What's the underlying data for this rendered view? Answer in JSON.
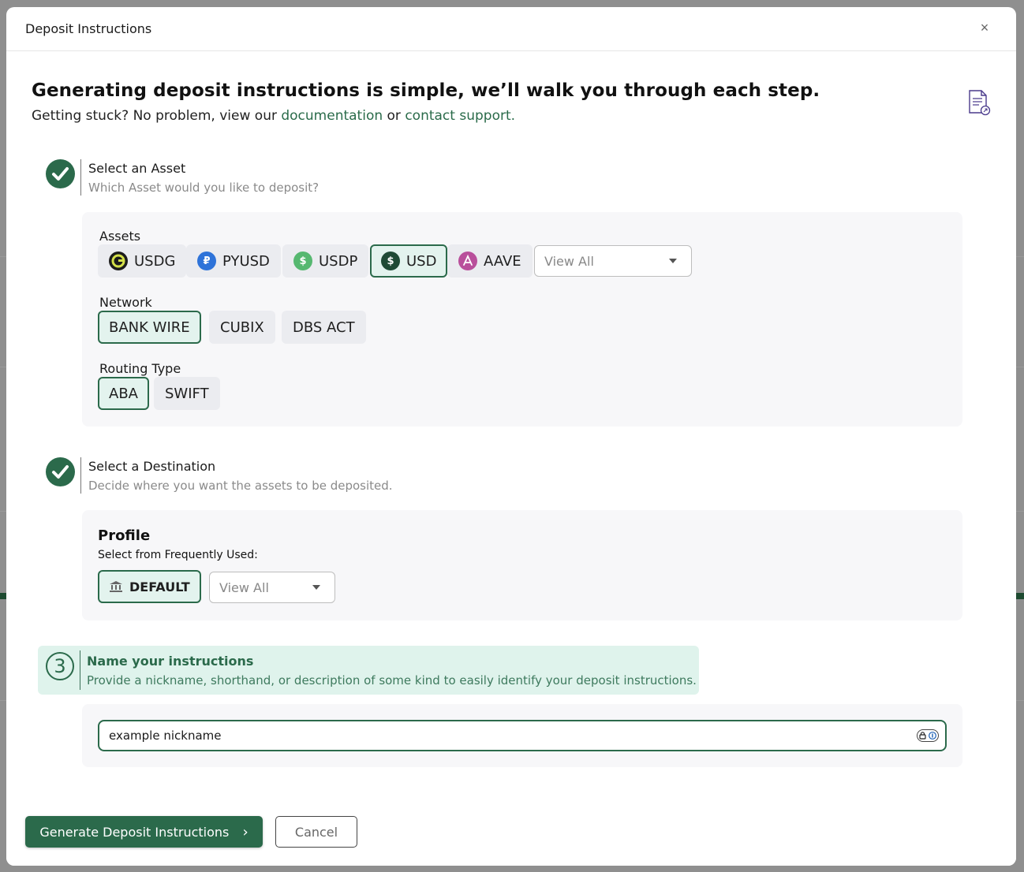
{
  "modal": {
    "title": "Deposit Instructions",
    "close_symbol": "×"
  },
  "hero": {
    "title": "Generating deposit instructions is simple, we’ll walk you through each step.",
    "sub_prefix": "Getting stuck? No problem, view our ",
    "documentation_link": "documentation",
    "sub_middle": " or ",
    "support_link": "contact support."
  },
  "step1": {
    "title": "Select an Asset",
    "description": "Which Asset would you like to deposit?",
    "assets_label": "Assets",
    "assets": [
      {
        "label": "USDG",
        "icon": "usdg-icon",
        "color": "#d4e04a"
      },
      {
        "label": "PYUSD",
        "icon": "pyusd-icon",
        "color": "#2e73d9"
      },
      {
        "label": "USDP",
        "icon": "usdp-icon",
        "color": "#56b870"
      },
      {
        "label": "USD",
        "icon": "usd-icon",
        "color": "#1f4a35",
        "selected": true
      },
      {
        "label": "AAVE",
        "icon": "aave-icon",
        "color": "#b94f9b"
      }
    ],
    "assets_view_all": "View All",
    "network_label": "Network",
    "networks": [
      "BANK WIRE",
      "CUBIX",
      "DBS ACT"
    ],
    "selected_network": "BANK WIRE",
    "routing_label": "Routing Type",
    "routing_types": [
      "ABA",
      "SWIFT"
    ],
    "selected_routing": "ABA"
  },
  "step2": {
    "title": "Select a Destination",
    "description": "Decide where you want the assets to be deposited.",
    "profile_heading": "Profile",
    "profile_sub": "Select from Frequently Used:",
    "default_profile": "DEFAULT",
    "view_all": "View All"
  },
  "step3": {
    "number": "3",
    "title": "Name your instructions",
    "description": "Provide a nickname, shorthand, or description of some kind to easily identify your deposit instructions.",
    "nickname_value": "example nickname"
  },
  "footer": {
    "generate_label": "Generate Deposit Instructions",
    "generate_chevron": "›",
    "cancel_label": "Cancel"
  },
  "colors": {
    "brand": "#2b6a4b",
    "selected_bg": "#e3f3ee",
    "chip_bg": "#ebecf0",
    "panel_bg": "#f7f7f9"
  }
}
